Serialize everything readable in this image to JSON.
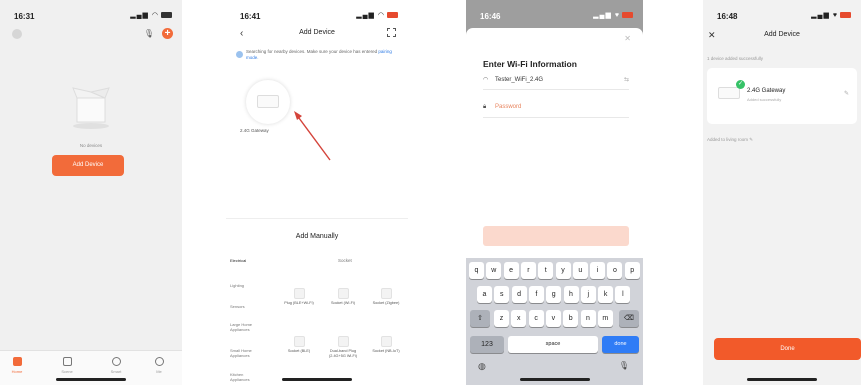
{
  "screen1": {
    "status_time": "16:31",
    "empty_text": "No devices",
    "add_device_button": "Add Device",
    "tabs": [
      "Home",
      "Scene",
      "Smart",
      "Me"
    ]
  },
  "screen2": {
    "status_time": "16:41",
    "title": "Add Device",
    "hint_text": "Searching for nearby devices. Make sure your device has entered",
    "hint_link": "pairing mode.",
    "found_device": "2.4G Gateway",
    "add_manually": "Add Manually",
    "categories": [
      "Electrical",
      "Lighting",
      "Sensors",
      "Large Home Appliances",
      "Small Home Appliances",
      "Kitchen Appliances"
    ],
    "socket_header": "Socket",
    "devices": [
      "Plug (BLE+Wi-Fi)",
      "Socket (Wi-Fi)",
      "Socket (Zigbee)",
      "Socket (BLE)",
      "Dual-band Plug (2.4G+5G Wi-Fi)",
      "Socket (NB-IoT)"
    ]
  },
  "screen3": {
    "status_time": "16:46",
    "title": "Enter Wi-Fi Information",
    "ssid": "Tester_WiFi_2.4G",
    "password_placeholder": "Password",
    "keys_row1": [
      "q",
      "w",
      "e",
      "r",
      "t",
      "y",
      "u",
      "i",
      "o",
      "p"
    ],
    "keys_row2": [
      "a",
      "s",
      "d",
      "f",
      "g",
      "h",
      "j",
      "k",
      "l"
    ],
    "keys_row3": [
      "z",
      "x",
      "c",
      "v",
      "b",
      "n",
      "m"
    ],
    "key_123": "123",
    "key_space": "space",
    "key_done": "done"
  },
  "screen4": {
    "status_time": "16:48",
    "title": "Add Device",
    "success_label": "1 device added successfully",
    "device_name": "2.4G Gateway",
    "device_status": "Added successfully",
    "device_location": "Added to living room",
    "done_button": "Done"
  },
  "colors": {
    "accent": "#f26b3a",
    "done_button": "#f25a2a",
    "link": "#2e7be5",
    "success": "#36c267",
    "keyboard_done": "#2f7cf6"
  }
}
